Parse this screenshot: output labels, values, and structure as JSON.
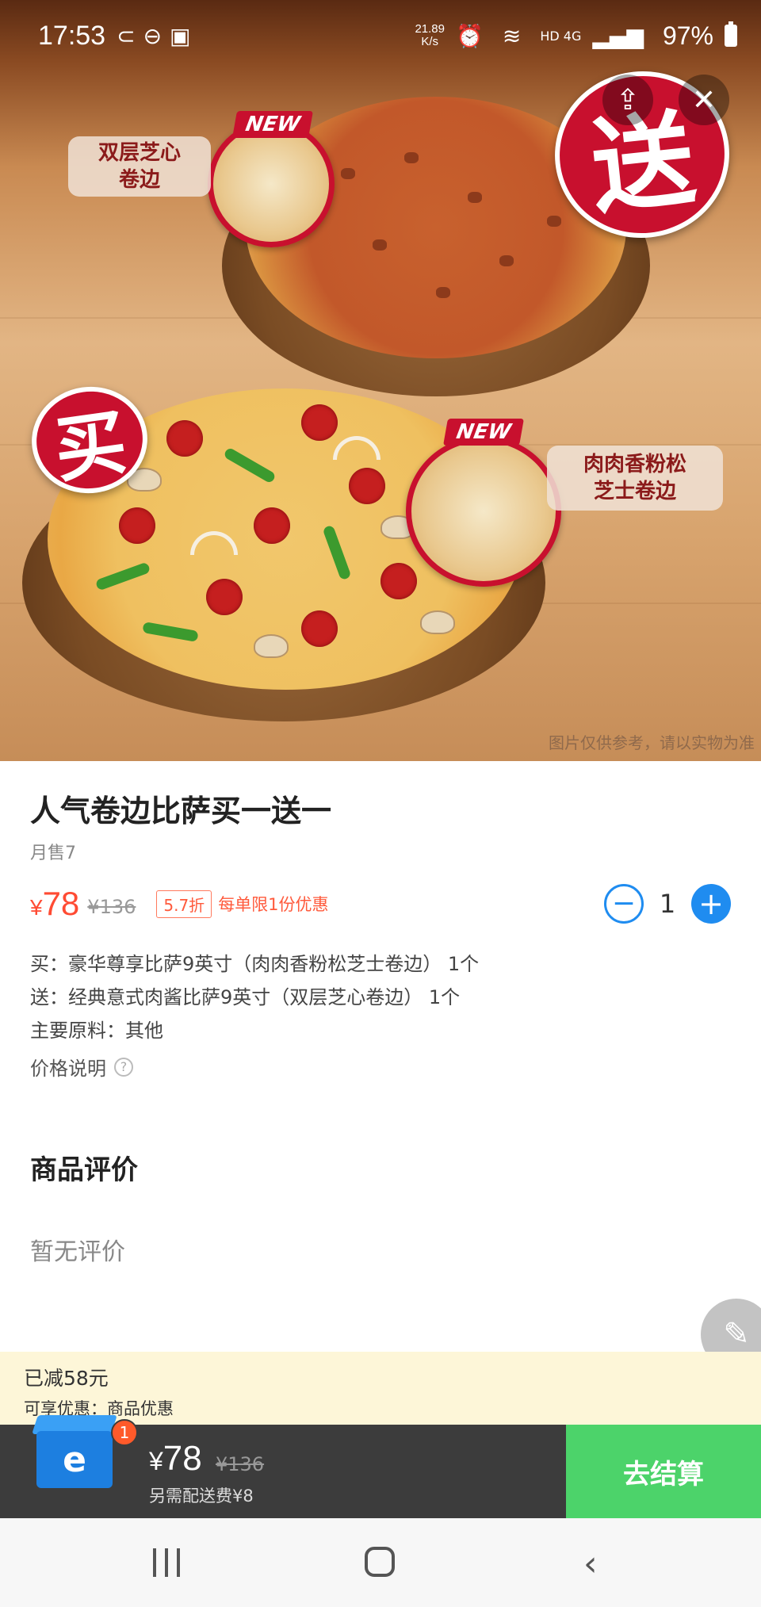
{
  "status_bar": {
    "time": "17:53",
    "net_speed_value": "21.89",
    "net_speed_unit": "K/s",
    "network": "HD 4G",
    "battery": "97%"
  },
  "hero": {
    "badge_send": "送",
    "badge_buy": "买",
    "new_tag_1": "NEW",
    "new_tag_2": "NEW",
    "label_top_line1": "双层芝心",
    "label_top_line2": "卷边",
    "label_bottom_line1": "肉肉香粉松",
    "label_bottom_line2": "芝士卷边",
    "disclaimer": "图片仅供参考，请以实物为准"
  },
  "product": {
    "title": "人气卷边比萨买一送一",
    "monthly_sales": "月售7",
    "price_symbol": "¥",
    "price": "78",
    "original_price": "¥136",
    "discount": "5.7折",
    "limit": "每单限1份优惠",
    "quantity": "1",
    "buy_line": "买：豪华尊享比萨9英寸（肉肉香粉松芝士卷边） 1个",
    "send_line": "送：经典意式肉酱比萨9英寸（双层芝心卷边） 1个",
    "ingredients": "主要原料：其他",
    "price_note": "价格说明"
  },
  "reviews": {
    "title": "商品评价",
    "empty": "暂无评价"
  },
  "promo": {
    "reduced": "已减58元",
    "available": "可享优惠：商品优惠"
  },
  "cart": {
    "count": "1",
    "price_symbol": "¥",
    "price": "78",
    "original_price": "¥136",
    "delivery_fee": "另需配送费¥8",
    "checkout_label": "去结算"
  },
  "colors": {
    "price_red": "#ff4b33",
    "stepper_blue": "#1f8cf0",
    "checkout_green": "#4cd36a",
    "promo_bg": "#fdf6d8",
    "badge_red": "#c8102e"
  },
  "icons": {
    "share": "share-icon",
    "close": "close-icon",
    "minus": "minus-icon",
    "plus": "plus-icon",
    "help": "help-icon",
    "edit": "pencil-icon",
    "cart": "cart-box-icon"
  }
}
